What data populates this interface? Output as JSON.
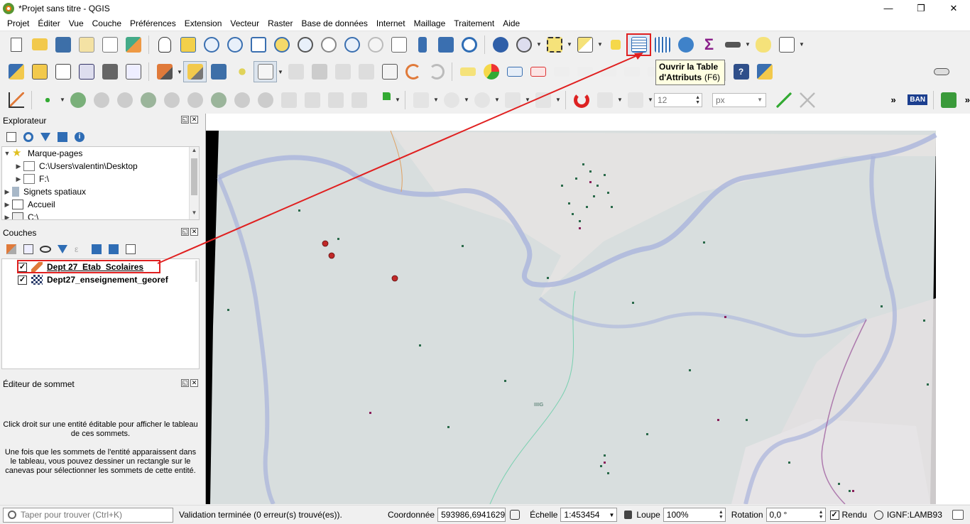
{
  "window": {
    "title": "*Projet sans titre - QGIS",
    "controls": [
      "—",
      "❐",
      "✕"
    ]
  },
  "menubar": [
    "Projet",
    "Éditer",
    "Vue",
    "Couche",
    "Préférences",
    "Extension",
    "Vecteur",
    "Raster",
    "Base de données",
    "Internet",
    "Maillage",
    "Traitement",
    "Aide"
  ],
  "toolbar3": {
    "tolerance_value": "12",
    "unit": "px",
    "more": "»",
    "ban_label": "BAN"
  },
  "tooltip": {
    "title": "Ouvrir la Table d'Attributs",
    "shortcut": "(F6)"
  },
  "explorer": {
    "title": "Explorateur",
    "items": [
      {
        "label": "Marque-pages",
        "level": 0,
        "expanded": true
      },
      {
        "label": "C:\\Users\\valentin\\Desktop",
        "level": 1
      },
      {
        "label": "F:\\",
        "level": 1
      },
      {
        "label": "Signets spatiaux",
        "level": 0
      },
      {
        "label": "Accueil",
        "level": 0
      },
      {
        "label": "C:\\",
        "level": 0
      }
    ]
  },
  "layers": {
    "title": "Couches",
    "items": [
      {
        "label": "Dept 27_Etab_Scolaires",
        "checked": "✓",
        "active": true
      },
      {
        "label": "Dept27_enseignement_georef",
        "checked": "✓",
        "active": false
      }
    ]
  },
  "vertex_editor": {
    "title": "Éditeur de sommet",
    "text1": "Click droit sur une entité éditable pour afficher le tableau de ces sommets.",
    "text2": "Une fois que les sommets de l'entité apparaissent dans le tableau, vous pouvez dessiner un rectangle sur le canevas pour sélectionner les sommets de cette entité."
  },
  "statusbar": {
    "search_placeholder": "Taper pour trouver (Ctrl+K)",
    "message": "Validation terminée (0 erreur(s) trouvé(es)).",
    "coord_label": "Coordonnée",
    "coord_value": "593986,6941629",
    "scale_label": "Échelle",
    "scale_value": "1:453454",
    "zoom_label": "Loupe",
    "zoom_value": "100%",
    "rotation_label": "Rotation",
    "rotation_value": "0,0 °",
    "render_label": "Rendu",
    "render_checked": "✓",
    "crs": "IGNF:LAMB93"
  },
  "map": {
    "center_label": "IIIIG"
  },
  "colors": {
    "accent": "#e02020",
    "map_bg": "#d8dede",
    "river": "#aab4dc"
  }
}
